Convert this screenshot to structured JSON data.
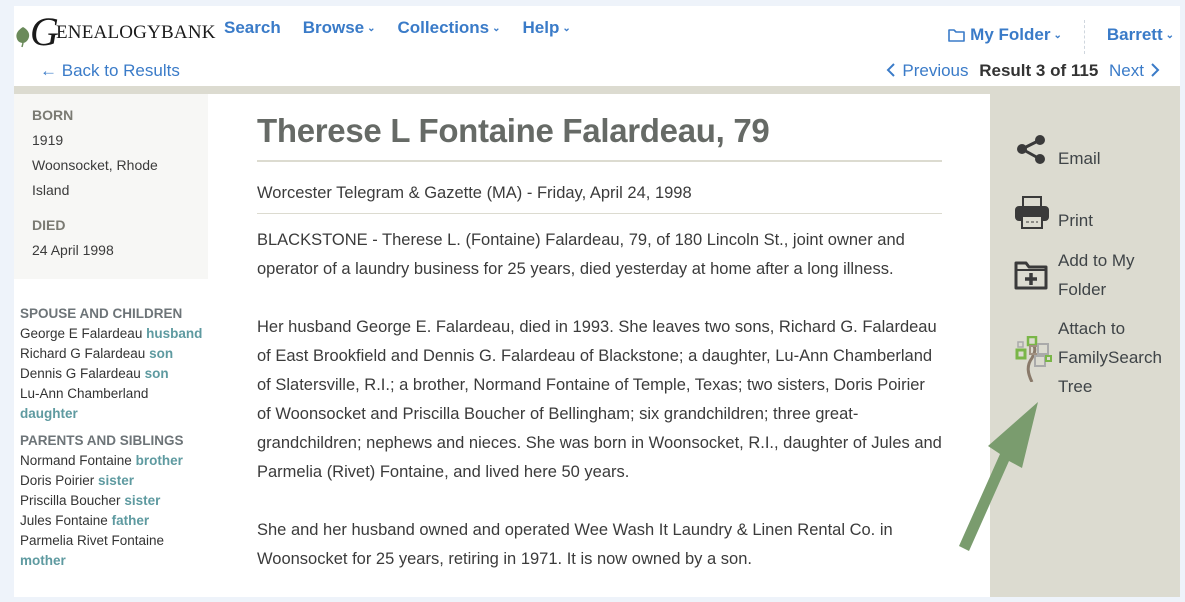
{
  "header": {
    "logo_initial": "G",
    "logo_text": "ENEALOGYBANK",
    "nav": [
      {
        "label": "Search",
        "has_caret": false
      },
      {
        "label": "Browse",
        "has_caret": true
      },
      {
        "label": "Collections",
        "has_caret": true
      },
      {
        "label": "Help",
        "has_caret": true
      }
    ],
    "my_folder_label": "My Folder",
    "user_label": "Barrett",
    "caret_glyph": "⌄"
  },
  "subnav": {
    "back_label": "Back to Results",
    "back_icon": "←",
    "previous_label": "Previous",
    "next_label": "Next",
    "result_text": "Result 3 of 115"
  },
  "vitals": {
    "born_label": "BORN",
    "born_year": "1919",
    "born_place_line1": "Woonsocket, Rhode",
    "born_place_line2": "Island",
    "died_label": "DIED",
    "died_date": "24 April 1998"
  },
  "relations": {
    "spouse_children_heading": "SPOUSE AND CHILDREN",
    "spouse_children": [
      {
        "name": "George E Falardeau",
        "role": "husband"
      },
      {
        "name": "Richard G Falardeau",
        "role": "son"
      },
      {
        "name": "Dennis G Falardeau",
        "role": "son"
      },
      {
        "name": "Lu-Ann Chamberland",
        "role": "daughter"
      }
    ],
    "parents_siblings_heading": "PARENTS AND SIBLINGS",
    "parents_siblings": [
      {
        "name": "Normand Fontaine",
        "role": "brother"
      },
      {
        "name": "Doris Poirier",
        "role": "sister"
      },
      {
        "name": "Priscilla Boucher",
        "role": "sister"
      },
      {
        "name": "Jules Fontaine",
        "role": "father"
      },
      {
        "name": "Parmelia Rivet Fontaine",
        "role": "mother"
      }
    ]
  },
  "article": {
    "title": "Therese L Fontaine Falardeau, 79",
    "source": "Worcester Telegram & Gazette (MA) - Friday, April 24, 1998",
    "paragraphs": [
      "BLACKSTONE - Therese L. (Fontaine) Falardeau, 79, of 180 Lincoln St., joint owner and operator of a laundry business for 25 years, died yesterday at home after a long illness.",
      "Her husband George E. Falardeau, died in 1993. She leaves two sons, Richard G. Falardeau of East Brookfield and Dennis G. Falardeau of Blackstone; a daughter, Lu-Ann Chamberland of Slatersville, R.I.; a brother, Normand Fontaine of Temple, Texas; two sisters, Doris Poirier of Woonsocket and Priscilla Boucher of Bellingham; six grandchildren; three great-grandchildren; nephews and nieces. She was born in Woonsocket, R.I., daughter of Jules and Parmelia (Rivet) Fontaine, and lived here 50 years.",
      "She and her husband owned and operated Wee Wash It Laundry & Linen Rental Co. in Woonsocket for 25 years, retiring in 1971. It is now owned by a son."
    ]
  },
  "actions": {
    "email_label": "Email",
    "print_label": "Print",
    "add_folder_line1": "Add to My",
    "add_folder_line2": "Folder",
    "familysearch_line1": "Attach to",
    "familysearch_line2": "FamilySearch",
    "familysearch_line3": "Tree"
  },
  "colors": {
    "link": "#3a7bc8",
    "relation_role": "#5e9aa0",
    "sidebar_bg": "#dcdbd0",
    "arrow": "#7a9c6e"
  }
}
